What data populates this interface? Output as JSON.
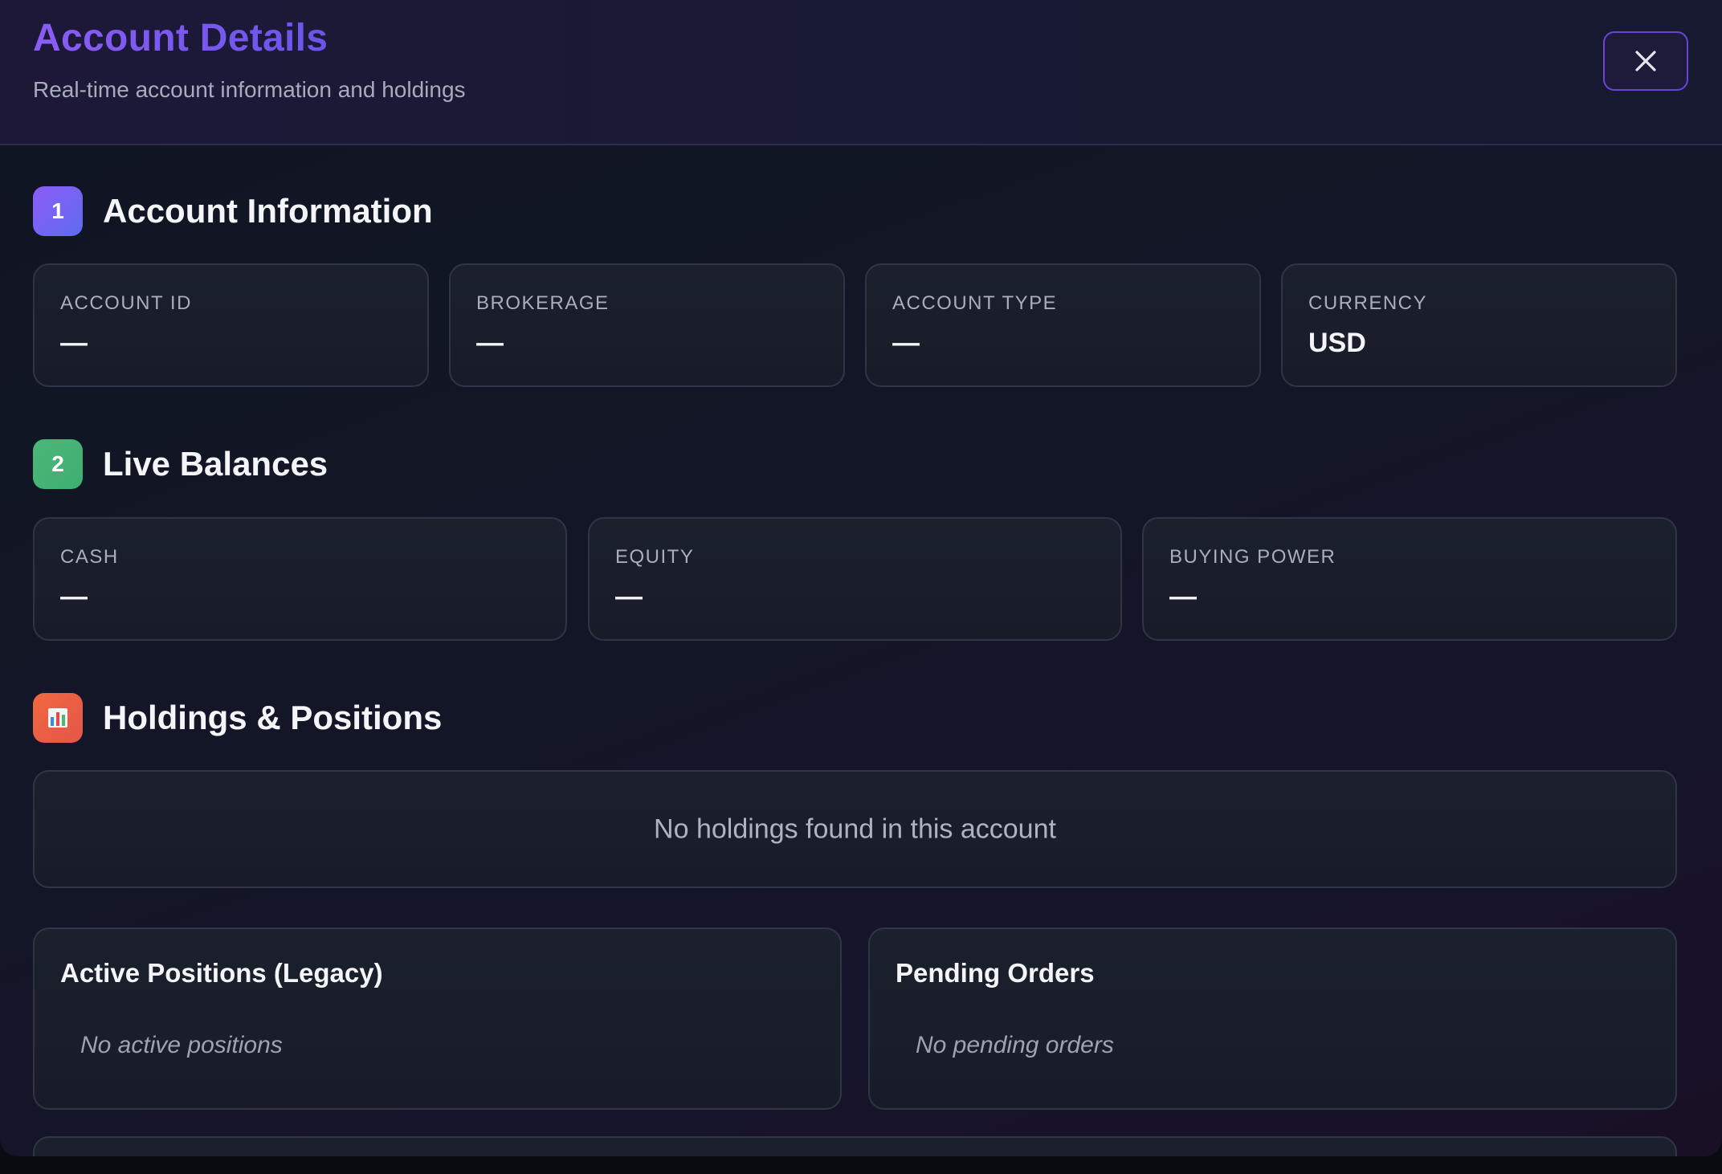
{
  "header": {
    "title": "Account Details",
    "subtitle": "Real-time account information and holdings",
    "close_icon": "close-icon"
  },
  "sections": {
    "account_info": {
      "number": "1",
      "title": "Account Information",
      "fields": [
        {
          "label": "ACCOUNT ID",
          "value": "—"
        },
        {
          "label": "BROKERAGE",
          "value": "—"
        },
        {
          "label": "ACCOUNT TYPE",
          "value": "—"
        },
        {
          "label": "CURRENCY",
          "value": "USD"
        }
      ]
    },
    "live_balances": {
      "number": "2",
      "title": "Live Balances",
      "fields": [
        {
          "label": "CASH",
          "value": "—"
        },
        {
          "label": "EQUITY",
          "value": "—"
        },
        {
          "label": "BUYING POWER",
          "value": "—"
        }
      ]
    },
    "holdings": {
      "icon": "bar-chart-icon",
      "title": "Holdings & Positions",
      "empty_text": "No holdings found in this account"
    }
  },
  "panels": {
    "active_positions": {
      "title": "Active Positions (Legacy)",
      "empty_text": "No active positions"
    },
    "pending_orders": {
      "title": "Pending Orders",
      "empty_text": "No pending orders"
    }
  },
  "colors": {
    "accent_purple": "#7a52ee",
    "badge_green": "#4ab876",
    "badge_orange": "#f0683e",
    "background": "#121626"
  }
}
